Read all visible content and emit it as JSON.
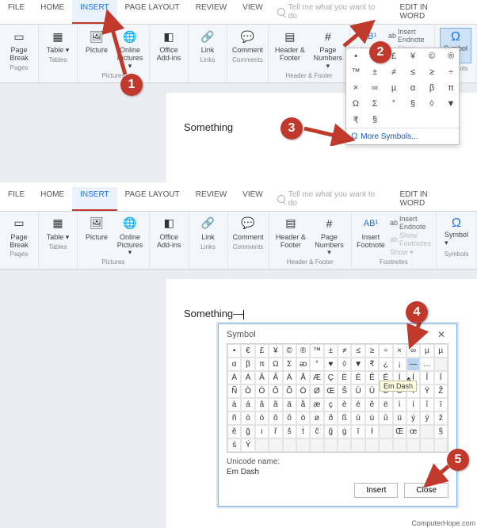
{
  "tabs": {
    "file": "FILE",
    "home": "HOME",
    "insert": "INSERT",
    "pagelayout": "PAGE LAYOUT",
    "review": "REVIEW",
    "view": "VIEW",
    "tellme": "Tell me what you want to do",
    "editword": "EDIT IN WORD"
  },
  "ribbon": {
    "pages": {
      "pagebreak": "Page\nBreak",
      "label": "Pages"
    },
    "tables": {
      "table": "Table\n▾",
      "label": "Tables"
    },
    "pictures": {
      "picture": "Picture",
      "online": "Online\nPictures ▾",
      "label": "Pictures"
    },
    "addins": {
      "office": "Office\nAdd-ins",
      "label": ""
    },
    "links": {
      "link": "Link",
      "label": "Links"
    },
    "comments": {
      "comment": "Comment",
      "label": "Comments"
    },
    "hf": {
      "header": "Header &\nFooter",
      "pagenum": "Page\nNumbers ▾",
      "label": "Header & Footer"
    },
    "footnotes": {
      "insert": "Insert\nFootnote",
      "endnote": "Insert Endnote",
      "show": "Show Footnotes",
      "showopt": "Show ▾",
      "label": "Footnotes"
    },
    "symbols": {
      "symbol": "Symbol\n▾",
      "label": "Symbols"
    }
  },
  "doc": {
    "text1": "Something",
    "text2": "Something—"
  },
  "dropdown": {
    "symbols": [
      "•",
      "€",
      "£",
      "¥",
      "©",
      "®",
      "™",
      "±",
      "≠",
      "≤",
      "≥",
      "÷",
      "×",
      "∞",
      "µ",
      "α",
      "β",
      "π",
      "Ω",
      "Σ",
      "°",
      "§",
      "◊",
      "▼",
      "₹",
      "§"
    ],
    "more": "More Symbols..."
  },
  "dialog": {
    "title": "Symbol",
    "rows": [
      [
        "•",
        "€",
        "£",
        "¥",
        "©",
        "®",
        "™",
        "±",
        "≠",
        "≤",
        "≥",
        "÷",
        "×",
        "∞",
        "µ",
        "µ"
      ],
      [
        "α",
        "β",
        "π",
        "Ω",
        "Σ",
        "ᴔ",
        "°",
        "♥",
        "◊",
        "▼",
        "₹",
        "¿",
        "¡",
        "—",
        "…",
        ""
      ],
      [
        "À",
        "Á",
        "Â",
        "Ã",
        "Ä",
        "Å",
        "Æ",
        "Ç",
        "È",
        "É",
        "Ê",
        "Ë",
        "Ì",
        "Í",
        "Î",
        "Ï"
      ],
      [
        "Ñ",
        "Ò",
        "Ó",
        "Ô",
        "Õ",
        "Ö",
        "Ø",
        "Œ",
        "Š",
        "Ù",
        "Ú",
        "Û",
        "Ü",
        "Ý",
        "Ÿ",
        "Ž"
      ],
      [
        "à",
        "á",
        "â",
        "ã",
        "ä",
        "å",
        "æ",
        "ç",
        "è",
        "é",
        "ê",
        "ë",
        "ì",
        "í",
        "î",
        "ï"
      ],
      [
        "ñ",
        "ò",
        "ó",
        "ô",
        "õ",
        "ö",
        "ø",
        "ð",
        "ß",
        "ù",
        "ú",
        "û",
        "ü",
        "ý",
        "ÿ",
        "ž"
      ],
      [
        "ě",
        "ğ",
        "ı",
        "ř",
        "š",
        "ṫ",
        "ĉ",
        "ĝ",
        "ġ",
        "ī",
        "ł",
        "",
        "Œ",
        "œ",
        "",
        "§"
      ],
      [
        "ś",
        "Ý",
        "",
        "",
        "",
        "",
        "",
        "",
        "",
        "",
        "",
        "",
        "",
        "",
        "",
        ""
      ]
    ],
    "selected": "—",
    "tooltip": "Em Dash",
    "uname_lbl": "Unicode name:",
    "uname_val": "Em Dash",
    "insert": "Insert",
    "close": "Close"
  },
  "badges": {
    "b1": "1",
    "b2": "2",
    "b3": "3",
    "b4": "4",
    "b5": "5"
  },
  "footer": "ComputerHope.com"
}
